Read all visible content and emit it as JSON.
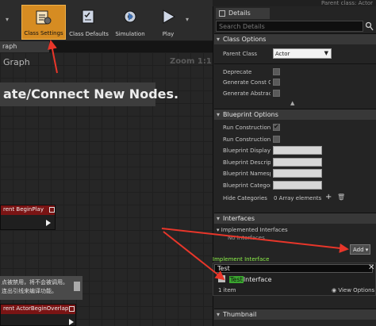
{
  "toolbar": {
    "class_settings": "Class Settings",
    "class_defaults": "Class Defaults",
    "simulation": "Simulation",
    "play": "Play",
    "dropdown_glyph": "▾"
  },
  "graph": {
    "tab": "raph",
    "title": "Graph",
    "zoom": "Zoom 1:1",
    "hint": "ate/Connect New Nodes.",
    "node_begin_play": "rent BeginPlay",
    "node_overlap": "rent ActorBeginOverlap",
    "comment_lines": [
      "点被禁用，将不会被调用。",
      "连出引线来编译功能。"
    ]
  },
  "details": {
    "parent_class_header": "Parent class: Actor",
    "tab": "Details",
    "search_placeholder": "Search Details",
    "class_options": {
      "header": "Class Options",
      "parent_class_label": "Parent Class",
      "parent_class_value": "Actor",
      "deprecate": "Deprecate",
      "generate_const_class": "Generate Const Cla",
      "generate_abstract": "Generate Abstract C"
    },
    "blueprint_options": {
      "header": "Blueprint Options",
      "run_construction_1": "Run Construction Sc",
      "run_construction_2": "Run Construction Sc",
      "display_name": "Blueprint Display N",
      "description": "Blueprint Descriptic",
      "namespace": "Blueprint Namespac",
      "category": "Blueprint Category",
      "hide_categories": "Hide Categories",
      "hide_categories_value": "0 Array elements",
      "add_glyph": "+",
      "trash_glyph": "🗑"
    },
    "interfaces": {
      "header": "Interfaces",
      "implemented_header": "Implemented Interfaces",
      "no_interfaces": "No Interfaces",
      "add_button": "Add",
      "add_dropdown": "▾"
    },
    "implement_interface": {
      "title": "Implement Interface",
      "search_value": "Test",
      "close_glyph": "✕",
      "item_match": "Test",
      "item_rest": "Interface",
      "count": "1 item",
      "view_options": "View Options"
    },
    "thumbnail": {
      "header": "Thumbnail"
    }
  },
  "colors": {
    "accent_orange": "#d68c22",
    "annotation_red": "#e8362a",
    "highlight_green": "#3aa62f",
    "popup_title_green": "#8df24a"
  }
}
